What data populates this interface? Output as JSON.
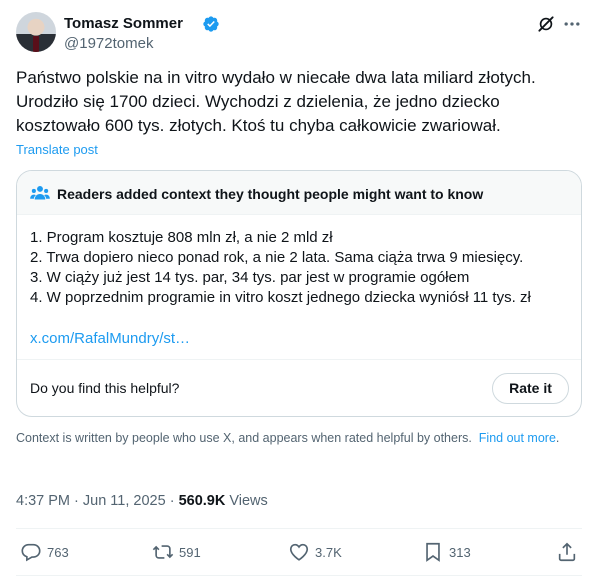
{
  "author": {
    "name": "Tomasz Sommer",
    "handle": "@1972tomek"
  },
  "tweet": {
    "text": "Państwo polskie na in vitro wydało w niecałe dwa lata miliard złotych. Urodziło się 1700 dzieci. Wychodzi z dzielenia, że jedno dziecko kosztowało 600 tys. złotych. Ktoś tu chyba całkowicie zwariował.",
    "translate_label": "Translate post"
  },
  "community_note": {
    "title": "Readers added context they thought people might want to know",
    "lines": [
      "1. Program kosztuje 808 mln zł, a nie 2 mld zł",
      "2. Trwa dopiero nieco ponad rok, a nie 2 lata. Sama ciąża trwa 9 miesięcy.",
      "3. W ciąży już jest 14 tys. par, 34 tys. par jest w programie ogółem",
      "4. W poprzednim programie in vitro koszt jednego dziecka wyniósł 11 tys. zł"
    ],
    "link": "x.com/RafalMundry/st…",
    "helpful_question": "Do you find this helpful?",
    "rate_label": "Rate it"
  },
  "context_footer": {
    "text": "Context is written by people who use X, and appears when rated helpful by others.",
    "link": "Find out more"
  },
  "meta": {
    "time": "4:37 PM",
    "date": "Jun 11, 2025",
    "views_count": "560.9K",
    "views_label": "Views"
  },
  "actions": {
    "replies": "763",
    "reposts": "591",
    "likes": "3.7K",
    "bookmarks": "313"
  },
  "colors": {
    "accent": "#1d9bf0",
    "secondary_text": "#536471",
    "border": "#cfd9de"
  }
}
